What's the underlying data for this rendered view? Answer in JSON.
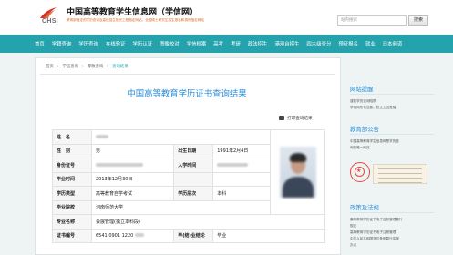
{
  "header": {
    "logo_text": "CHSI",
    "site_title": "中国高等教育学生信息网（学信网）",
    "tagline": "教育部指定的学历查询及高校招生阳光工程指定网站、全国硕士研究生招生报名和调剂指定网站",
    "search_placeholder": "站内搜索",
    "search_button": "搜索"
  },
  "nav": {
    "items": [
      "首页",
      "学籍查询",
      "学历查询",
      "在线验证",
      "学历认证",
      "图像校对",
      "学信档案",
      "高考",
      "考研",
      "政法招生",
      "港澳台招生",
      "四六级查分",
      "预征报名",
      "就业",
      "日本频道"
    ]
  },
  "breadcrumb": {
    "items": [
      "首页",
      "学信查询",
      "零散查询"
    ],
    "current": "查询结果"
  },
  "page": {
    "title": "中国高等教育学历证书查询结果",
    "print_label": "打印查询结果"
  },
  "record": {
    "name_label": "姓　名",
    "gender_label": "性　别",
    "gender": "男",
    "birth_label": "出生日期",
    "birth": "1991年2月4日",
    "id_label": "身份证号",
    "enroll_label": "入学时间",
    "grad_label": "毕业时间",
    "grad": "2013年12月30日",
    "type_label": "学历类型",
    "type": "高等教育自学考试",
    "level_label": "学历层次",
    "level": "本科",
    "school_label": "毕业院校",
    "school": "河南师范大学",
    "major_label": "专业名称",
    "major": "会展管理(独立本科段)",
    "cert_label": "证书编号",
    "cert": "6541 0901 1220",
    "result_label": "毕(结)业结论",
    "result": "毕业"
  },
  "sidebar": {
    "tips_title": "网站提醒",
    "tips_lines": [
      "谨防学历查询陷阱",
      "学信网所有信息，防止上当受骗"
    ],
    "dept_title": "教育部公告",
    "dept_lines": [
      "中国高等教育学生信息网是学历查",
      "询的唯一网站"
    ],
    "law_title": "政策及法规",
    "law_lines": [
      "高等教育学历证书电子注册管理暂行",
      "规定",
      "高等教育学历证书电子注册管理",
      "中华人民共和国学位条例暂行实施",
      "办法"
    ]
  },
  "colors": {
    "brand": "#25a3ad",
    "title_blue": "#2a8ed8",
    "tagline_orange": "#d96b2b"
  }
}
